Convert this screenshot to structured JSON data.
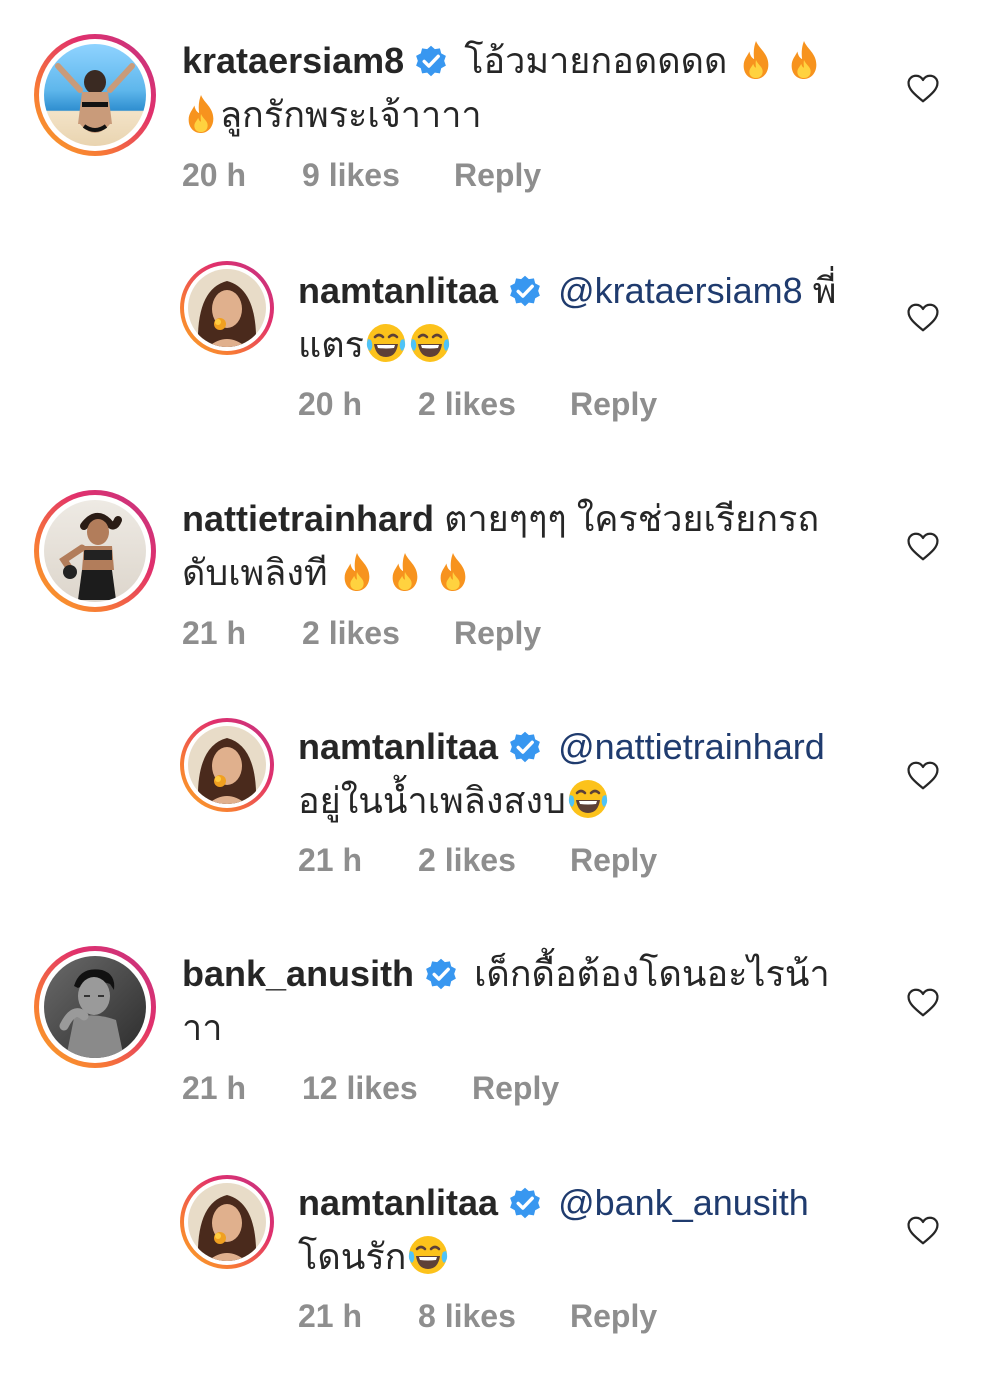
{
  "comments": [
    {
      "username": "krataersiam8",
      "text_line1": "โอ้วมายกอดดดด",
      "text_line2": "ลูกรักพระเจ้าาาา",
      "mention": "",
      "time": "20 h",
      "likes": "9 likes",
      "reply": "Reply"
    },
    {
      "username": "namtanlitaa",
      "text_line1": "พี่",
      "text_line2": "แตร",
      "mention": "@krataersiam8",
      "time": "20 h",
      "likes": "2 likes",
      "reply": "Reply"
    },
    {
      "username": "nattietrainhard",
      "text_line1": "ตายๆๆๆ ใครช่วยเรียกรถ",
      "text_line2": "ดับเพลิงที",
      "mention": "",
      "time": "21 h",
      "likes": "2 likes",
      "reply": "Reply"
    },
    {
      "username": "namtanlitaa",
      "text_line1": "",
      "text_line2": "อยู่ในน้ำเพลิงสงบ",
      "mention": "@nattietrainhard",
      "time": "21 h",
      "likes": "2 likes",
      "reply": "Reply"
    },
    {
      "username": "bank_anusith",
      "text_line1": "เด็กดื้อต้องโดนอะไรน้า",
      "text_line2": "าา",
      "mention": "",
      "time": "21 h",
      "likes": "12 likes",
      "reply": "Reply"
    },
    {
      "username": "namtanlitaa",
      "text_line1": "",
      "text_line2": "โดนรัก",
      "mention": "@bank_anusith",
      "time": "21 h",
      "likes": "8 likes",
      "reply": "Reply"
    }
  ],
  "colors": {
    "verified": "#3897f0",
    "meta": "#8e8e8e",
    "mention": "#1f3b6e"
  },
  "icons": [
    "verified-badge-icon",
    "fire-emoji",
    "laughing-emoji",
    "heart-outline-icon"
  ]
}
